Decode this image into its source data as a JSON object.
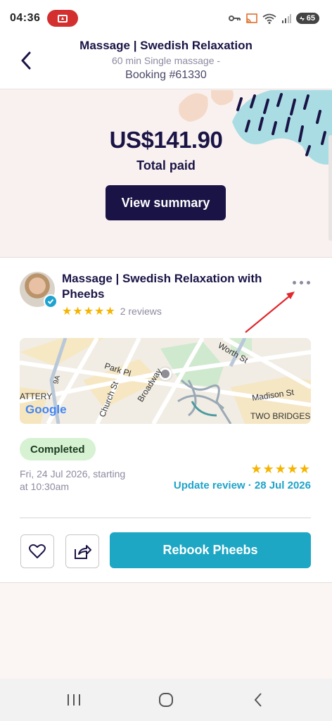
{
  "status_bar": {
    "time": "04:36",
    "battery": "65"
  },
  "header": {
    "title": "Massage | Swedish Relaxation",
    "subtitle": "60 min Single massage -",
    "booking": "Booking #61330"
  },
  "payment": {
    "amount": "US$141.90",
    "label": "Total paid",
    "summary_button": "View summary"
  },
  "provider": {
    "title": "Massage  |  Swedish Relaxation with Pheebs",
    "stars": "★★★★★",
    "reviews": "2 reviews"
  },
  "map": {
    "labels": [
      "Park Pl",
      "Church St",
      "Broadway",
      "Worth St",
      "Madison St",
      "TWO BRIDGES",
      "ATTERY",
      "9A"
    ],
    "provider": "Google"
  },
  "booking_status": {
    "badge": "Completed",
    "date_line1": "Fri, 24 Jul 2026, starting",
    "date_line2": "at 10:30am",
    "my_stars": "★★★★★",
    "update_review": "Update review · 28 Jul 2026"
  },
  "actions": {
    "rebook": "Rebook Pheebs"
  },
  "colors": {
    "navy": "#1a1446",
    "teal": "#1ea7c4",
    "star": "#f5b400",
    "completed_bg": "#d6f2d2"
  }
}
